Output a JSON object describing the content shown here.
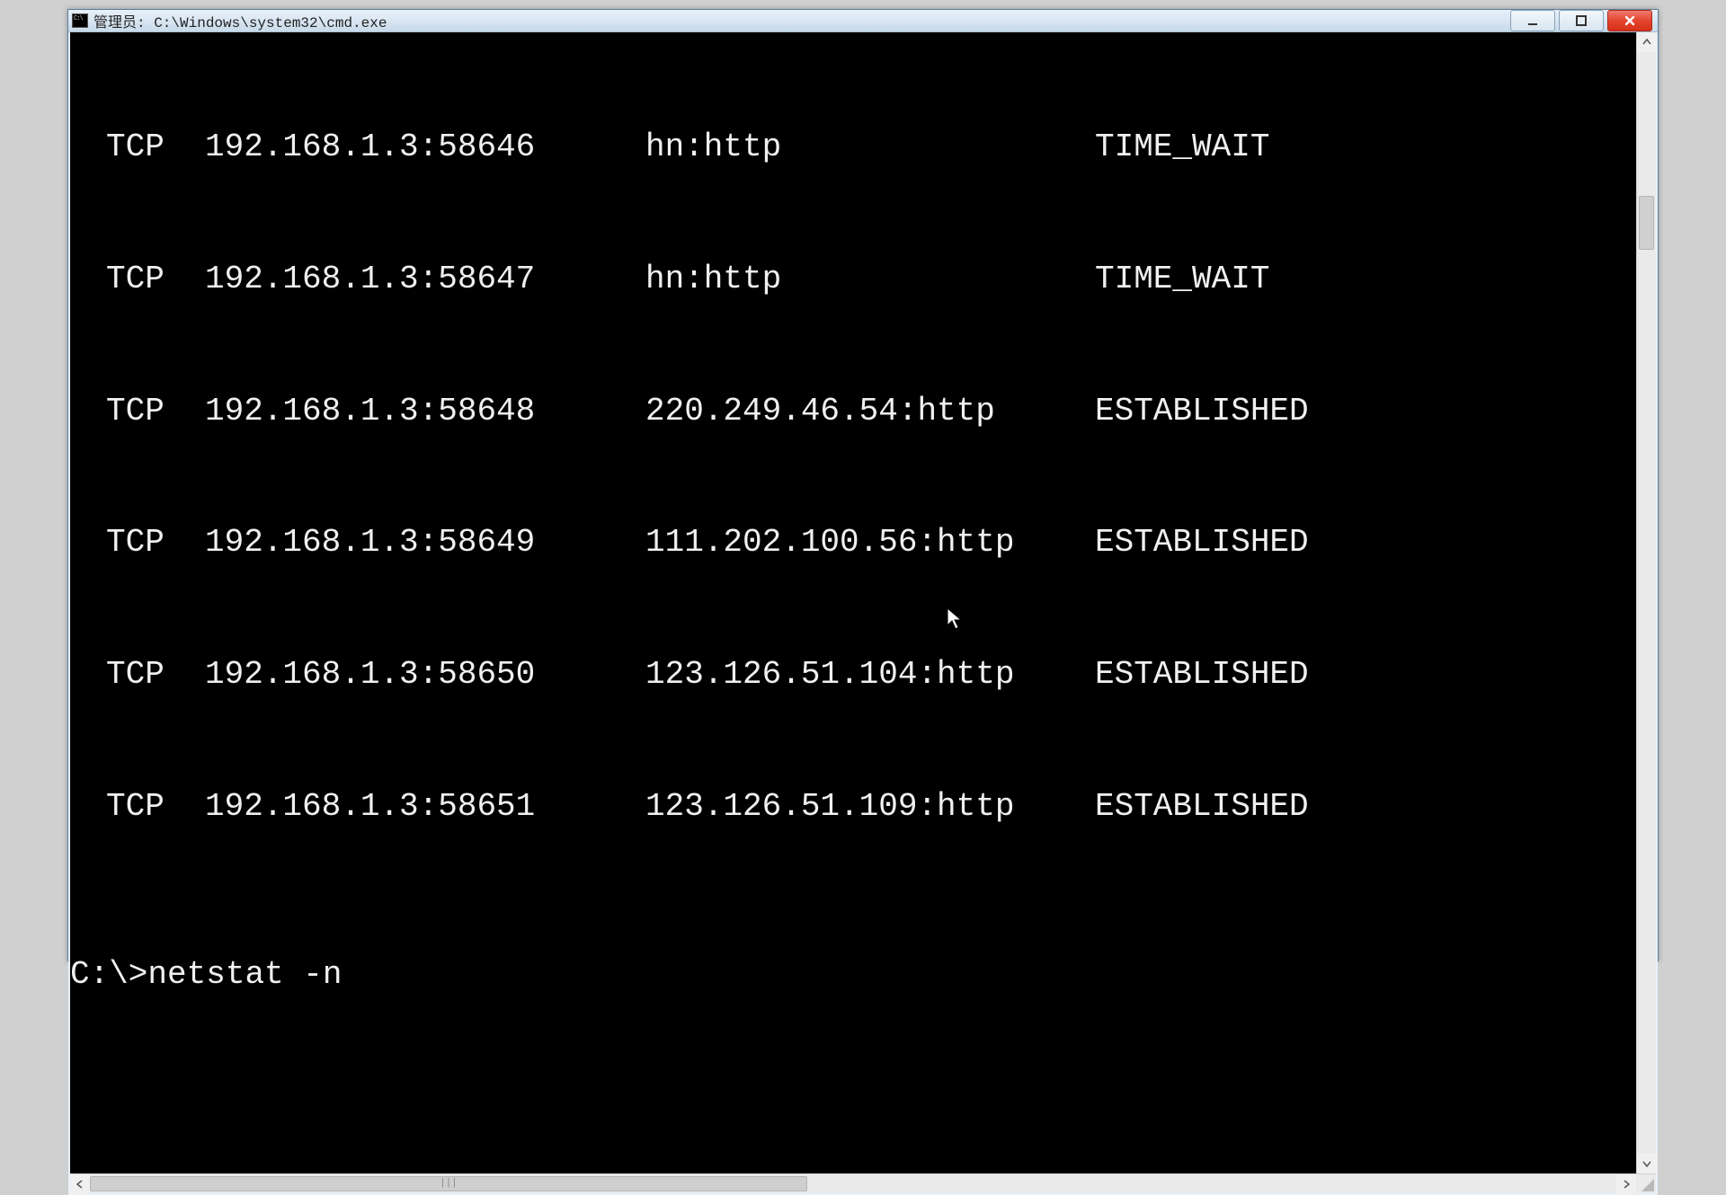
{
  "window": {
    "title": "管理员: C:\\Windows\\system32\\cmd.exe"
  },
  "terminal": {
    "rows": [
      {
        "proto": "TCP",
        "local": "192.168.1.3:58646",
        "remote": "hn:http",
        "state": "TIME_WAIT"
      },
      {
        "proto": "TCP",
        "local": "192.168.1.3:58647",
        "remote": "hn:http",
        "state": "TIME_WAIT"
      },
      {
        "proto": "TCP",
        "local": "192.168.1.3:58648",
        "remote": "220.249.46.54:http",
        "state": "ESTABLISHED"
      },
      {
        "proto": "TCP",
        "local": "192.168.1.3:58649",
        "remote": "111.202.100.56:http",
        "state": "ESTABLISHED"
      },
      {
        "proto": "TCP",
        "local": "192.168.1.3:58650",
        "remote": "123.126.51.104:http",
        "state": "ESTABLISHED"
      },
      {
        "proto": "TCP",
        "local": "192.168.1.3:58651",
        "remote": "123.126.51.109:http",
        "state": "ESTABLISHED"
      }
    ],
    "prompt": "C:\\>",
    "command": "netstat -n"
  },
  "scroll": {
    "h_thumb_label": "|||"
  }
}
